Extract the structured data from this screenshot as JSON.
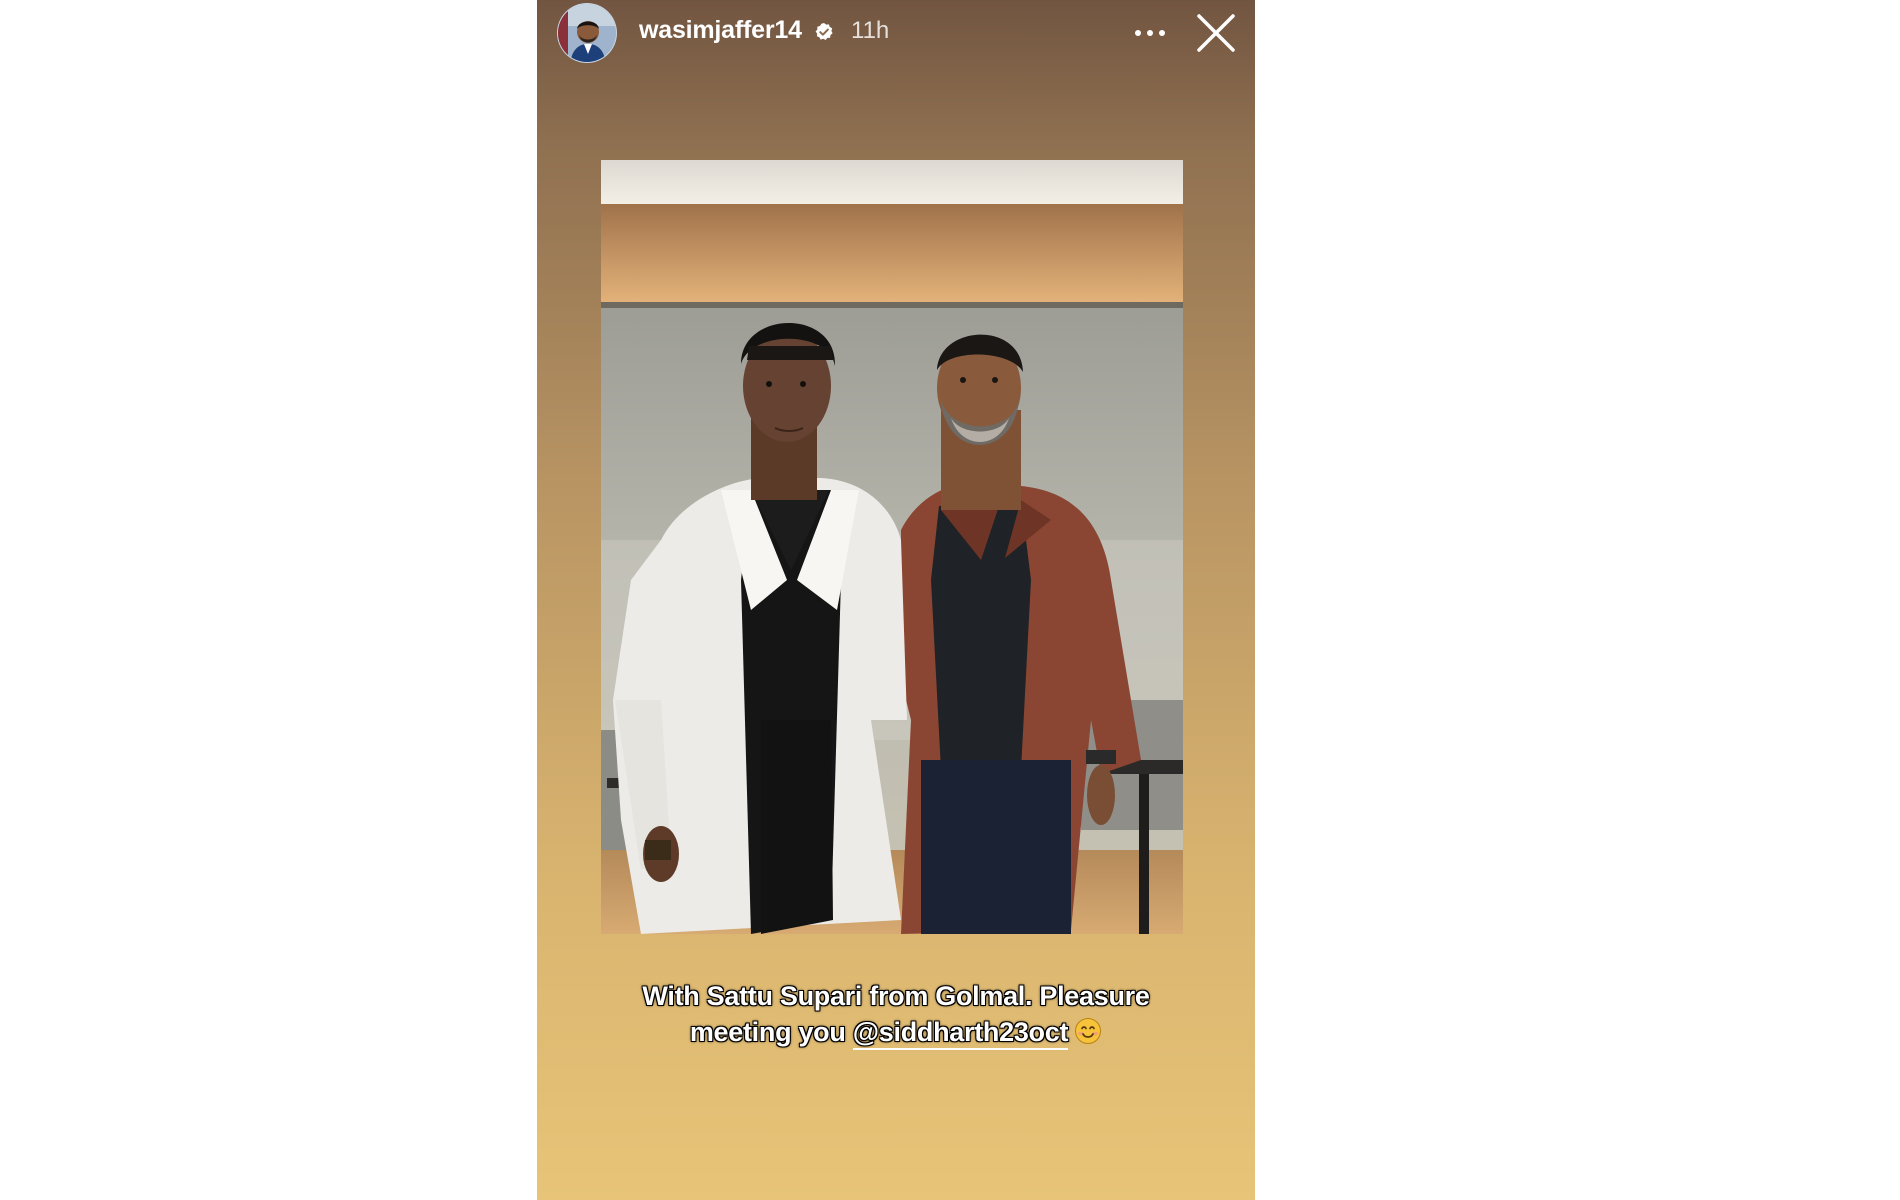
{
  "header": {
    "username": "wasimjaffer14",
    "time": "11h",
    "verified": true,
    "icons": {
      "avatar": "profile-avatar",
      "verified": "verified-badge-icon",
      "more": "more-options-icon",
      "close": "close-icon"
    }
  },
  "caption": {
    "line1": "With Sattu Supari from Golmal. Pleasure",
    "line2_prefix": "meeting you ",
    "mention": "@siddharth23oct",
    "emoji": "smiling-face-emoji"
  },
  "colors": {
    "story_top": "#725541",
    "story_bottom": "#e7c477",
    "page_background": "#ffffff"
  }
}
